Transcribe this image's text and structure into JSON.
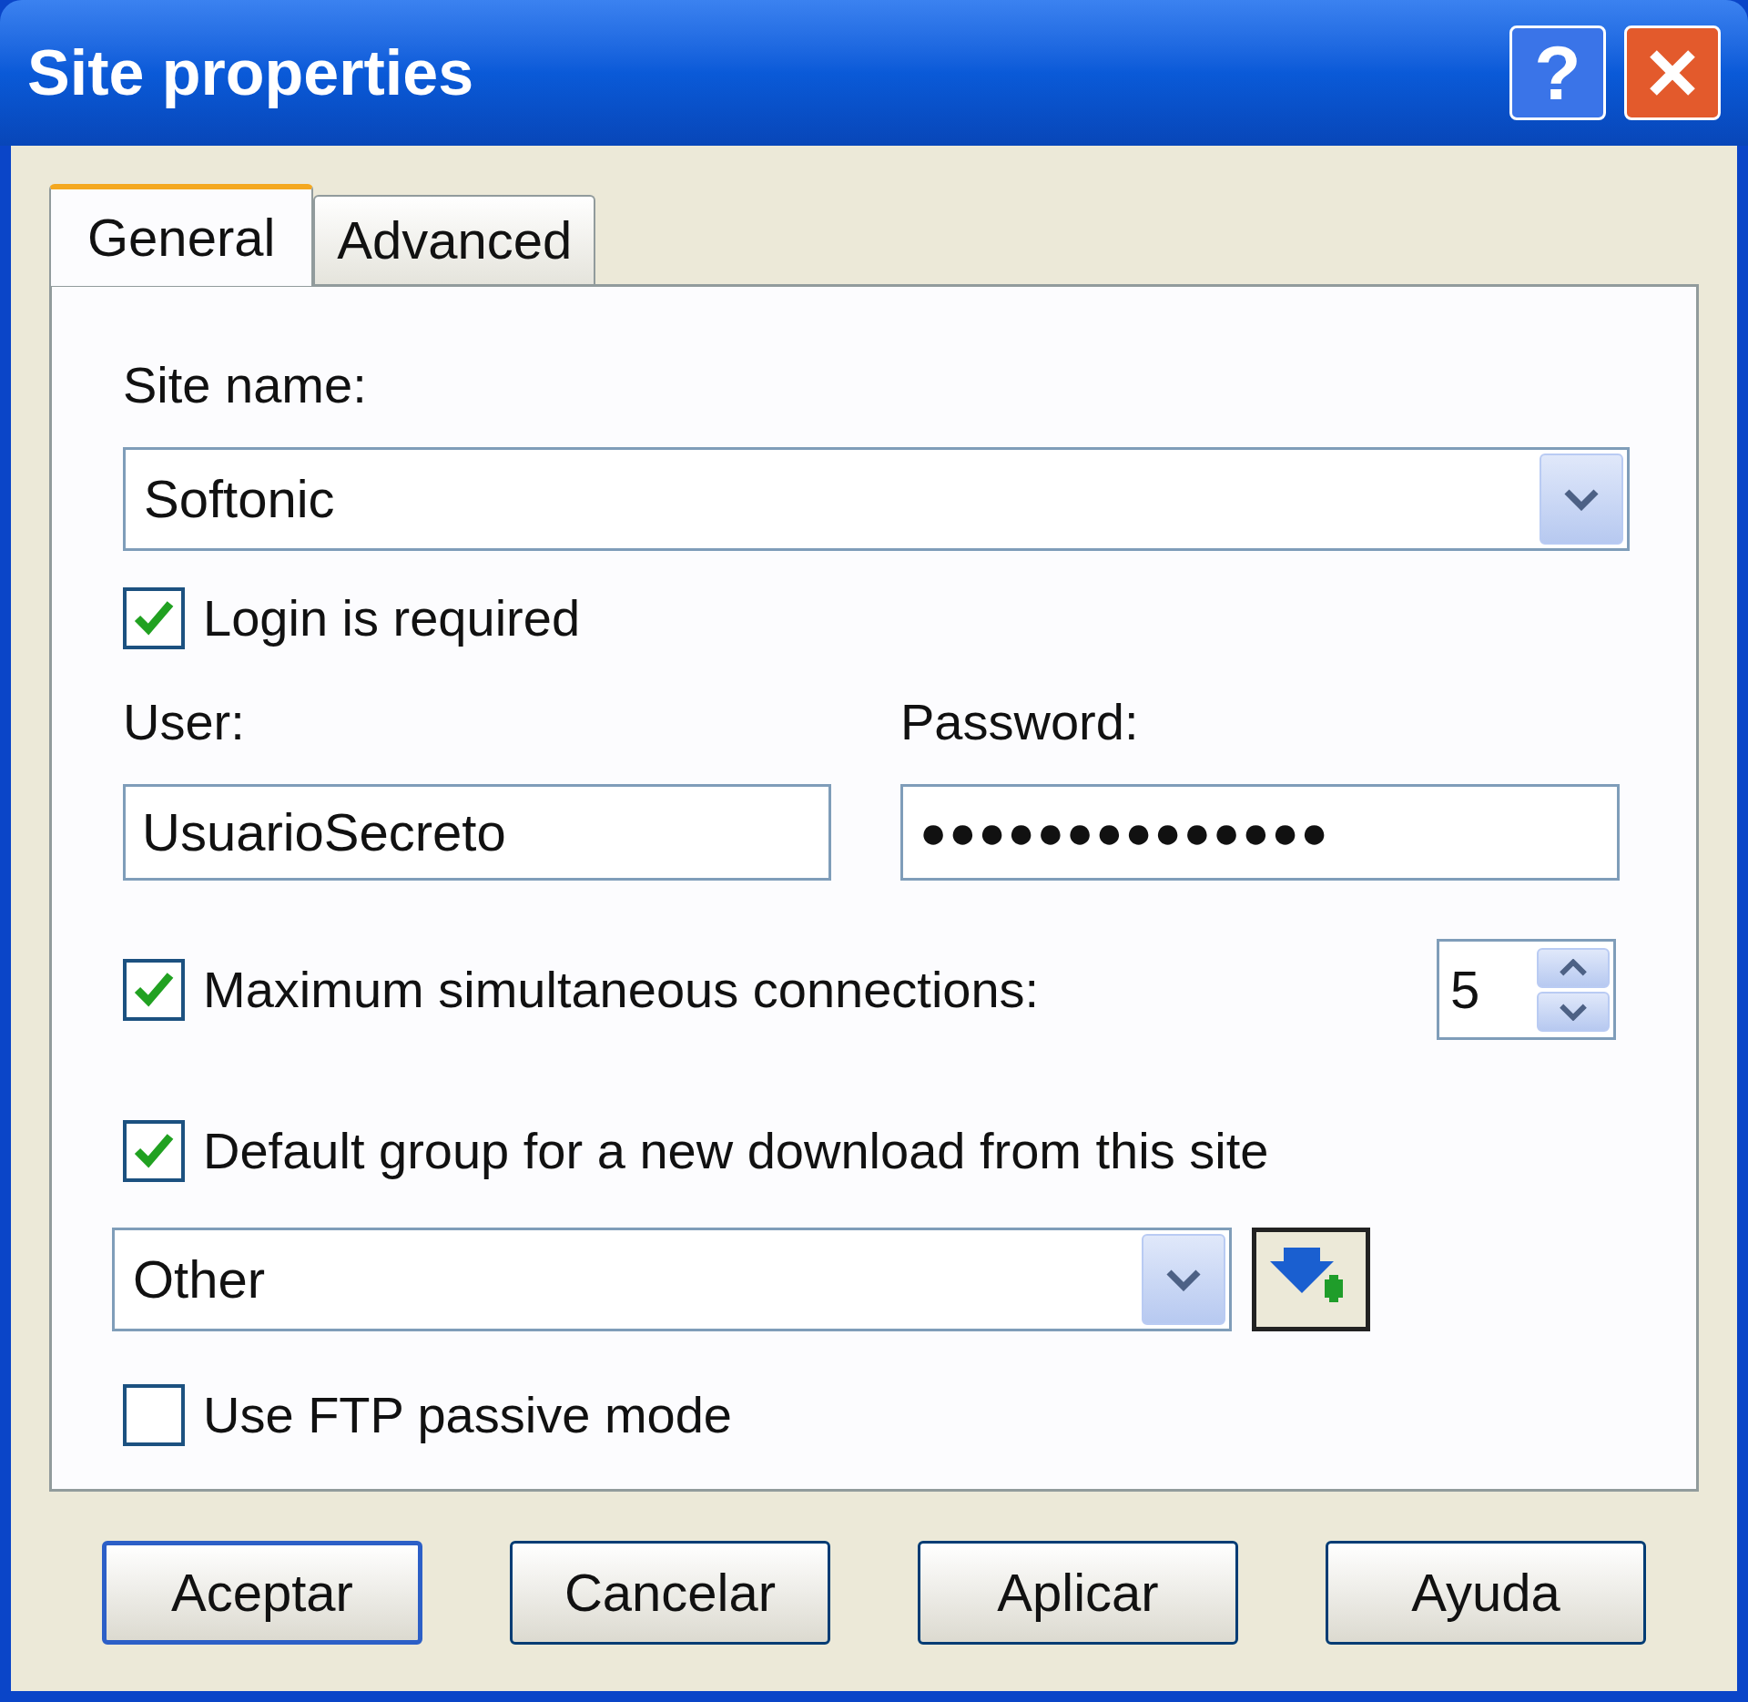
{
  "window": {
    "title": "Site properties",
    "help": "?"
  },
  "tabs": [
    {
      "label": "General",
      "selected": true
    },
    {
      "label": "Advanced",
      "selected": false
    }
  ],
  "site_name": {
    "label": "Site name:",
    "value": "Softonic"
  },
  "login_required": {
    "label": "Login is required",
    "checked": true
  },
  "user": {
    "label": "User:",
    "value": "UsuarioSecreto"
  },
  "password": {
    "label": "Password:",
    "value": "●●●●●●●●●●●●●●"
  },
  "max_connections": {
    "label": "Maximum simultaneous connections:",
    "checked": true,
    "value": "5"
  },
  "default_group": {
    "label": "Default group for a new download from this site",
    "checked": true,
    "value": "Other"
  },
  "passive_mode": {
    "label": "Use FTP passive mode",
    "checked": false
  },
  "buttons": [
    {
      "label": "Aceptar",
      "default": true
    },
    {
      "label": "Cancelar",
      "default": false
    },
    {
      "label": "Aplicar",
      "default": false
    },
    {
      "label": "Ayuda",
      "default": false
    }
  ]
}
